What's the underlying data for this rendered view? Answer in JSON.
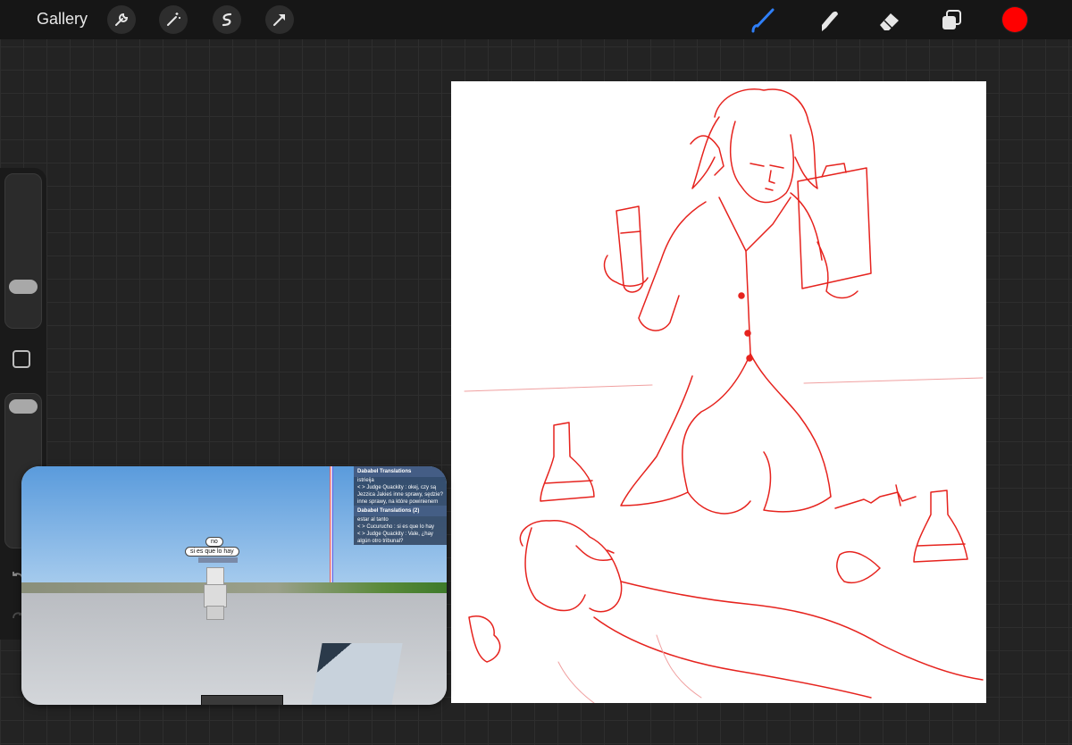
{
  "topbar": {
    "gallery_label": "Gallery",
    "left_tools": [
      "wrench-icon",
      "magic-wand-icon",
      "selection-icon",
      "transform-arrow-icon"
    ],
    "right_tools": [
      "brush-icon",
      "smudge-icon",
      "eraser-icon",
      "layers-icon"
    ],
    "accent_color": "#2f7ff7",
    "current_color": "#ff0000"
  },
  "sidebar": {
    "brush_size_level": 0.27,
    "opacity_level": 0.95
  },
  "pip": {
    "chat_title_1": "Dababel Translations",
    "chat_lines_1": [
      "istrieija",
      "< > Judge Quackity : okej, czy są",
      "Jezzica Jakieś inne sprawy, sędzie?",
      "inne sprawy, na które powinienem"
    ],
    "chat_title_2": "Dababel Translations (2)",
    "chat_lines_2": [
      "estar al tanto",
      "< > Cucurucho : si es que lo hay",
      "< > Judge Quackity : Vale, ¿hay",
      "algún otro tribunal?"
    ],
    "bubble_1": "no",
    "bubble_2": "si es que lo hay"
  }
}
